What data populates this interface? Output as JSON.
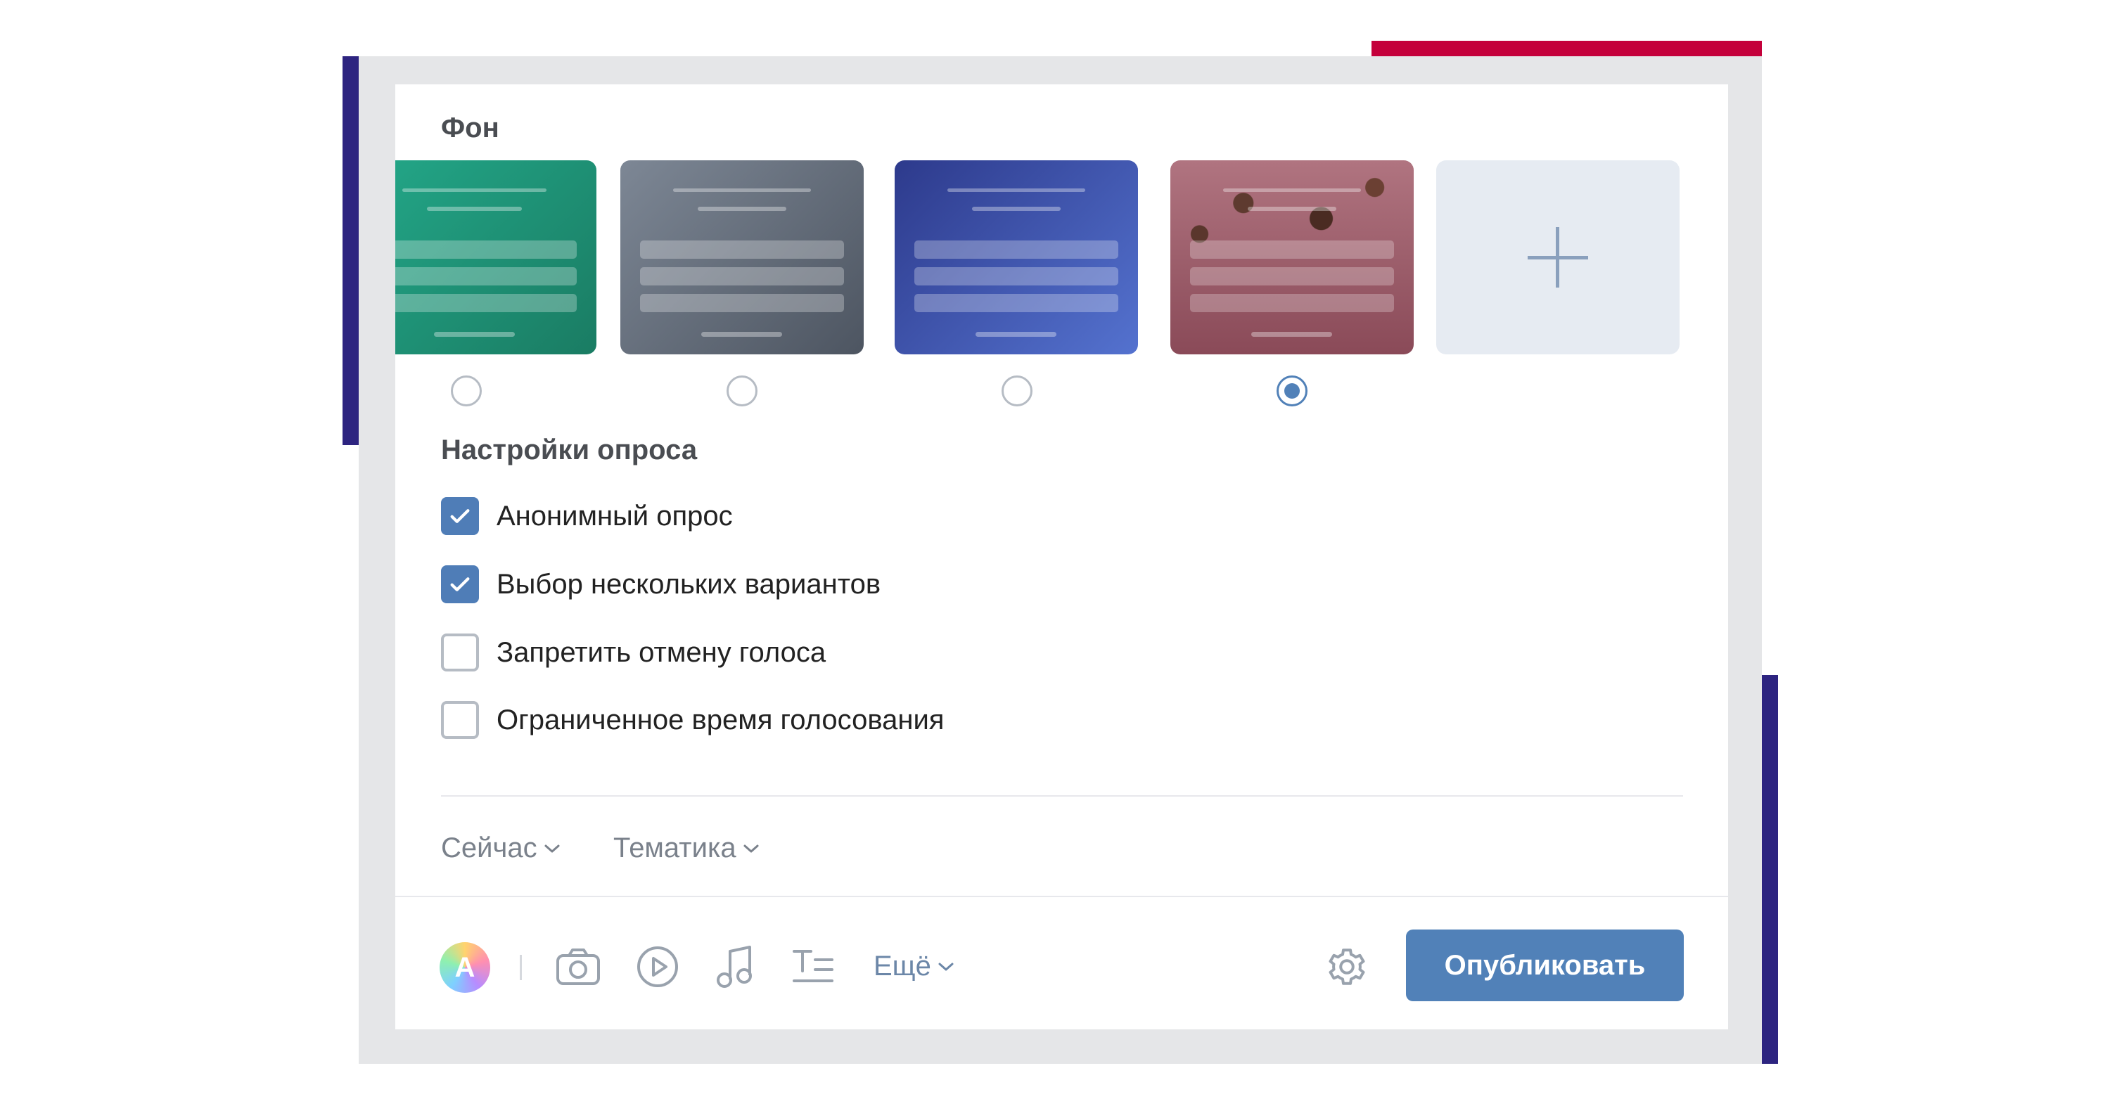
{
  "background_section": {
    "title": "Фон",
    "swatches": [
      {
        "name": "green",
        "selected": false
      },
      {
        "name": "gray",
        "selected": false
      },
      {
        "name": "blue",
        "selected": false
      },
      {
        "name": "photo-pink",
        "selected": true
      }
    ],
    "add_icon": "plus-icon"
  },
  "poll_settings": {
    "title": "Настройки опроса",
    "options": [
      {
        "label": "Анонимный опрос",
        "checked": true
      },
      {
        "label": "Выбор нескольких вариантов",
        "checked": true
      },
      {
        "label": "Запретить отмену голоса",
        "checked": false
      },
      {
        "label": "Ограниченное время голосования",
        "checked": false
      }
    ]
  },
  "meta": {
    "time_label": "Сейчас",
    "topic_label": "Тематика"
  },
  "toolbar": {
    "avatar_letter": "A",
    "icons": [
      "camera-icon",
      "video-play-icon",
      "music-note-icon",
      "text-format-icon"
    ],
    "more_label": "Ещё",
    "settings_icon": "gear-icon",
    "publish_label": "Опубликовать"
  },
  "colors": {
    "accent_blue": "#5181b8",
    "frame_red": "#c4003b",
    "frame_purple": "#2d2480"
  }
}
